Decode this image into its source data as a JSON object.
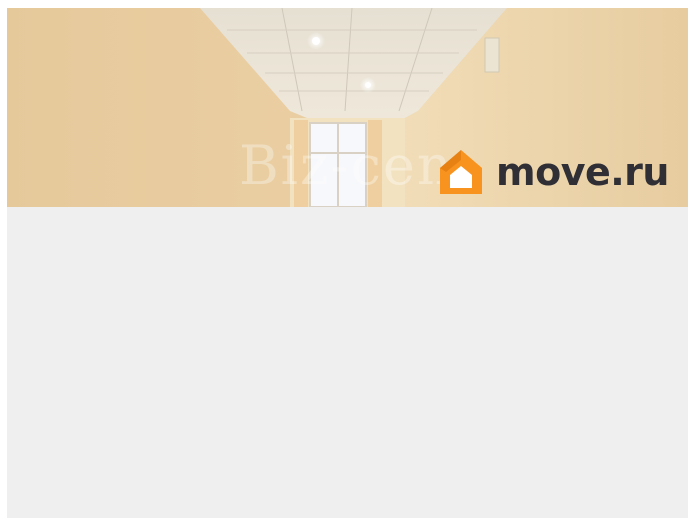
{
  "photo": {
    "subject": "hallway-interior",
    "watermark_text": "Biz-cen",
    "logo": {
      "text": "move.ru",
      "icon": "house-logo-icon",
      "brand_orange": "#f7931e",
      "brand_dark": "#2f2f35"
    }
  },
  "colors": {
    "wall_warm": "#e8cfa3",
    "ceiling": "#e9e3d6",
    "placeholder_bg": "#efefef"
  }
}
